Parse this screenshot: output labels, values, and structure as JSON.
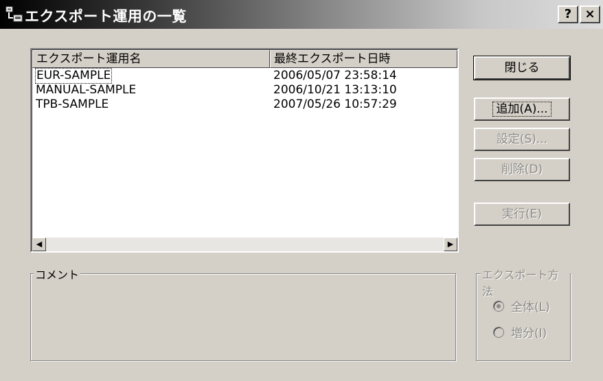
{
  "window": {
    "title": "エクスポート運用の一覧",
    "help_label": "?",
    "close_label": "×"
  },
  "list": {
    "columns": [
      "エクスポート運用名",
      "最終エクスポート日時"
    ],
    "rows": [
      {
        "name": "EUR-SAMPLE",
        "date": "2006/05/07 23:58:14"
      },
      {
        "name": "MANUAL-SAMPLE",
        "date": "2006/10/21 13:13:10"
      },
      {
        "name": "TPB-SAMPLE",
        "date": "2007/05/26 10:57:29"
      }
    ]
  },
  "buttons": {
    "close": "閉じる",
    "add": "追加(A)...",
    "settings": "設定(S)...",
    "delete": "削除(D)",
    "run": "実行(E)"
  },
  "comment": {
    "label": "コメント"
  },
  "export_method": {
    "label": "エクスポート方法",
    "options": [
      "全体(L)",
      "増分(I)"
    ],
    "selected_index": 0
  }
}
